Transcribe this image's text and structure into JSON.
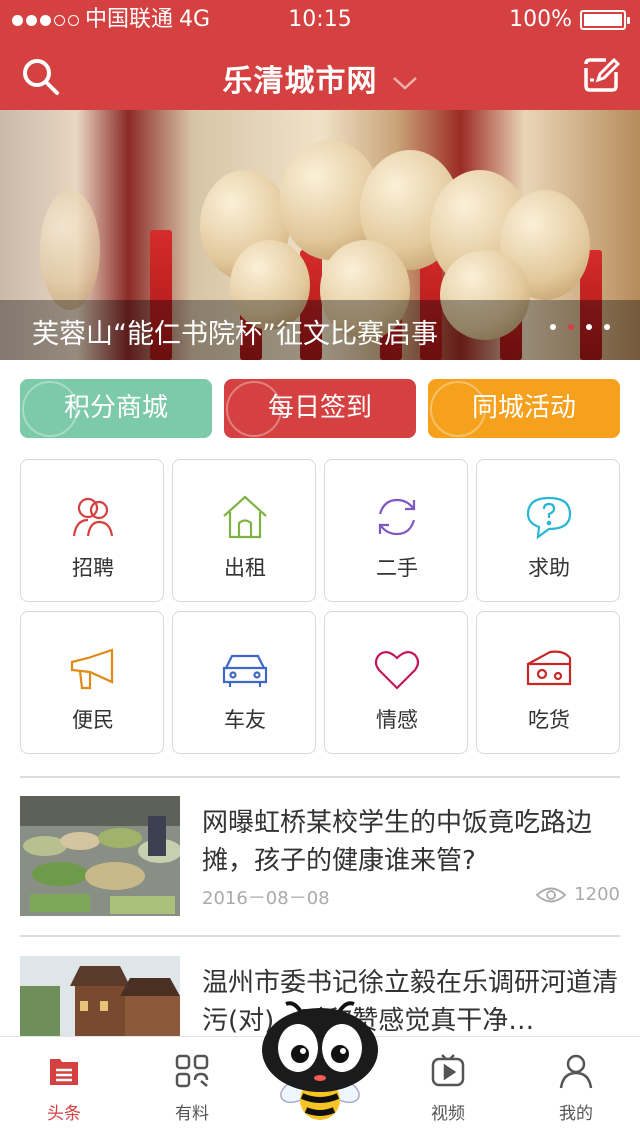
{
  "status": {
    "carrier": "中国联通",
    "network": "4G",
    "time": "10:15",
    "battery": "100%"
  },
  "nav": {
    "title": "乐清城市网"
  },
  "banner": {
    "title": "芙蓉山“能仁书院杯”征文比赛启事",
    "pages": 4,
    "active_page": 1
  },
  "quick_actions": [
    {
      "label": "积分商城",
      "color": "#7ccaa8"
    },
    {
      "label": "每日签到",
      "color": "#d54040"
    },
    {
      "label": "同城活动",
      "color": "#f5a11d"
    }
  ],
  "categories": [
    {
      "label": "招聘",
      "icon": "people-icon",
      "color": "#d54040"
    },
    {
      "label": "出租",
      "icon": "house-icon",
      "color": "#7cb342"
    },
    {
      "label": "二手",
      "icon": "recycle-icon",
      "color": "#7e57c2"
    },
    {
      "label": "求助",
      "icon": "question-bubble-icon",
      "color": "#29b6d6"
    },
    {
      "label": "便民",
      "icon": "megaphone-icon",
      "color": "#e08a16"
    },
    {
      "label": "车友",
      "icon": "car-icon",
      "color": "#3f67c6"
    },
    {
      "label": "情感",
      "icon": "heart-icon",
      "color": "#c2185b"
    },
    {
      "label": "吃货",
      "icon": "cheese-icon",
      "color": "#c62828"
    }
  ],
  "news": [
    {
      "headline": "网曝虹桥某校学生的中饭竟吃路边摊，孩子的健康谁来管?",
      "date": "2016－08－08",
      "views": "1200"
    },
    {
      "headline": "温州市委书记徐立毅在乐调研河道清污(对)…时称赞感觉真干净…",
      "date": "",
      "views": ""
    }
  ],
  "tabs": [
    {
      "label": "头条",
      "icon": "headlines-icon",
      "active": true
    },
    {
      "label": "有料",
      "icon": "grid-icon",
      "active": false
    },
    {
      "label": "",
      "icon": "bee-mascot-icon",
      "active": false
    },
    {
      "label": "视频",
      "icon": "video-icon",
      "active": false
    },
    {
      "label": "我的",
      "icon": "user-icon",
      "active": false
    }
  ],
  "colors": {
    "brand": "#d54040"
  }
}
